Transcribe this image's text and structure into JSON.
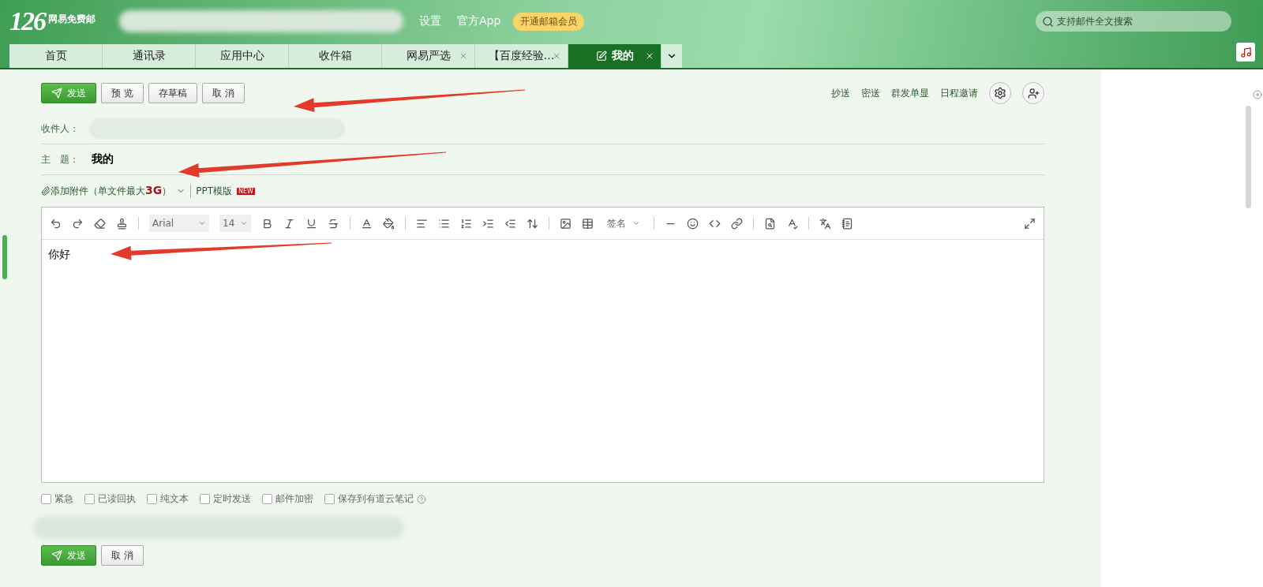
{
  "header": {
    "logo": "126",
    "brand": "网易免费邮",
    "links": [
      "设置",
      "官方App"
    ],
    "vip_badge": "开通邮箱会员",
    "search": {
      "placeholder": "支持邮件全文搜索"
    }
  },
  "tabs": [
    {
      "label": "首页",
      "closable": false,
      "selected": false
    },
    {
      "label": "通讯录",
      "closable": false,
      "selected": false
    },
    {
      "label": "应用中心",
      "closable": false,
      "selected": false
    },
    {
      "label": "收件箱",
      "closable": false,
      "selected": false
    },
    {
      "label": "网易严选",
      "closable": true,
      "selected": false
    },
    {
      "label": "【百度经验...",
      "closable": true,
      "selected": false
    },
    {
      "label": "我的",
      "closable": true,
      "selected": true
    }
  ],
  "compose": {
    "actions": [
      {
        "label": "发送",
        "kind": "primary"
      },
      {
        "label": "预 览",
        "kind": "plain"
      },
      {
        "label": "存草稿",
        "kind": "plain"
      },
      {
        "label": "取 消",
        "kind": "plain"
      }
    ],
    "extra_links": [
      "抄送",
      "密送",
      "群发单显",
      "日程邀请"
    ],
    "recipient_label": "收件人：",
    "subject_label": "主　题：",
    "subject": "我的",
    "attach": "添加附件（单文件最大**3G**）",
    "ppt": "PPT模版",
    "ppt_badge": "NEW",
    "editor": {
      "font": "Arial",
      "size": "14",
      "signature": "签名",
      "body": "你好"
    },
    "options": [
      {
        "label": "紧急",
        "checked": false
      },
      {
        "label": "已读回执",
        "checked": false
      },
      {
        "label": "纯文本",
        "checked": false
      },
      {
        "label": "定时发送",
        "checked": false
      },
      {
        "label": "邮件加密",
        "checked": false
      },
      {
        "label": "保存到有道云笔记",
        "checked": false
      }
    ],
    "bottom_actions": [
      {
        "label": "发送",
        "kind": "primary"
      },
      {
        "label": "取 消",
        "kind": "plain"
      }
    ]
  }
}
